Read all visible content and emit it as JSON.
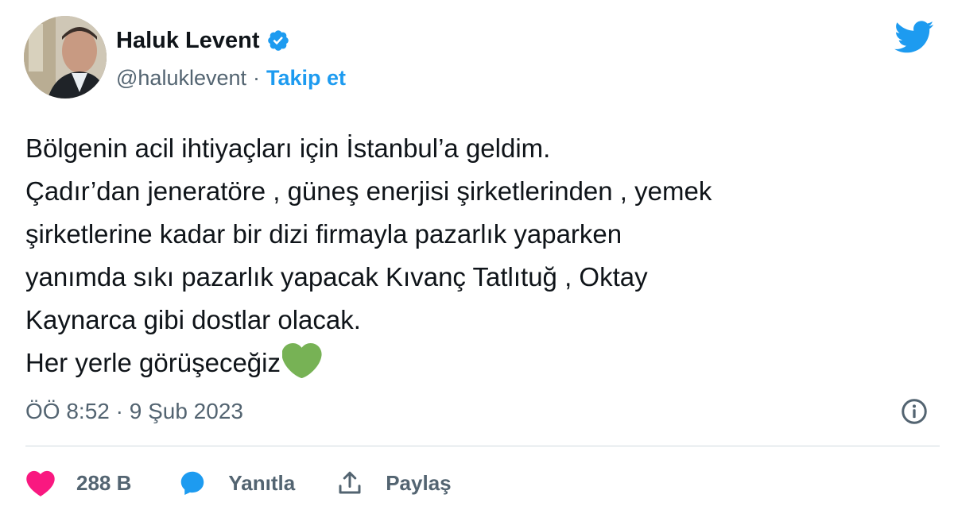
{
  "author": {
    "name": "Haluk Levent",
    "handle": "@haluklevent",
    "separator": "·",
    "follow_label": "Takip et"
  },
  "tweet": {
    "lines": [
      "Bölgenin acil ihtiyaçları için İstanbul’a geldim.",
      "Çadır’dan jeneratöre , güneş enerjisi şirketlerinden , yemek",
      "şirketlerine kadar bir dizi firmayla pazarlık yaparken",
      "yanımda sıkı pazarlık yapacak Kıvanç Tatlıtuğ , Oktay",
      "Kaynarca gibi dostlar olacak.",
      "Her yerle görüşeceğiz"
    ],
    "trailing_emoji": "green-heart-icon",
    "timestamp": "ÖÖ 8:52 · 9 Şub 2023"
  },
  "actions": {
    "like_count": "288 B",
    "reply_label": "Yanıtla",
    "share_label": "Paylaş"
  },
  "icons": {
    "verified": "verified-badge-icon",
    "brand": "twitter-bird-icon",
    "info": "info-icon",
    "like": "heart-icon",
    "reply": "reply-bubble-icon",
    "share": "share-icon"
  },
  "colors": {
    "accent": "#1d9bf0",
    "text": "#0f1419",
    "muted": "#536471",
    "like": "#f91880",
    "green_heart": "#77b255",
    "divider": "#cfd9de"
  }
}
